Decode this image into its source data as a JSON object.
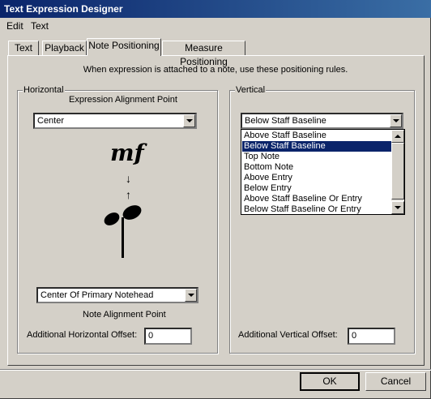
{
  "window": {
    "title": "Text Expression Designer"
  },
  "menu": [
    "Edit",
    "Text"
  ],
  "tabs": [
    "Text",
    "Playback",
    "Note Positioning",
    "Measure Positioning"
  ],
  "hint": "When expression is attached to a note, use these positioning rules.",
  "horizontal": {
    "group_label": "Horizontal",
    "expression_alignment_label": "Expression Alignment Point",
    "expression_alignment_value": "Center",
    "dynamic_text": "mf",
    "arrow_down": "↓",
    "arrow_up": "↑",
    "note_alignment_value": "Center Of Primary Notehead",
    "note_alignment_label": "Note Alignment Point",
    "offset_label": "Additional Horizontal Offset:",
    "offset_value": "0"
  },
  "vertical": {
    "group_label": "Vertical",
    "selected_value": "Below Staff Baseline",
    "options": [
      "Above Staff Baseline",
      "Below Staff Baseline",
      "Top Note",
      "Bottom Note",
      "Above Entry",
      "Below Entry",
      "Above Staff Baseline Or Entry",
      "Below Staff Baseline Or Entry"
    ],
    "offset_label": "Additional Vertical Offset:",
    "offset_value": "0"
  },
  "buttons": {
    "ok": "OK",
    "cancel": "Cancel"
  }
}
